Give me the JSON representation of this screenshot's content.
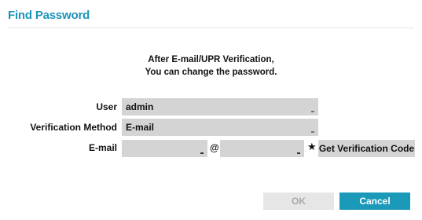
{
  "dialog": {
    "title": "Find Password"
  },
  "message": {
    "line1": "After E-mail/UPR Verification,",
    "line2": "You can change the password."
  },
  "form": {
    "user_label": "User",
    "user_value": "admin",
    "method_label": "Verification Method",
    "method_value": "E-mail",
    "email_label": "E-mail",
    "email_local_value": "",
    "email_domain_value": "",
    "at_symbol": "@",
    "favorite_symbol": "★",
    "verify_button_label": "Get Verification Code"
  },
  "footer": {
    "ok_label": "OK",
    "cancel_label": "Cancel"
  },
  "colors": {
    "accent": "#1a99b9",
    "title": "#1e93b9",
    "field_bg": "#d4d4d4",
    "disabled_button_bg": "#e6e6e6"
  }
}
